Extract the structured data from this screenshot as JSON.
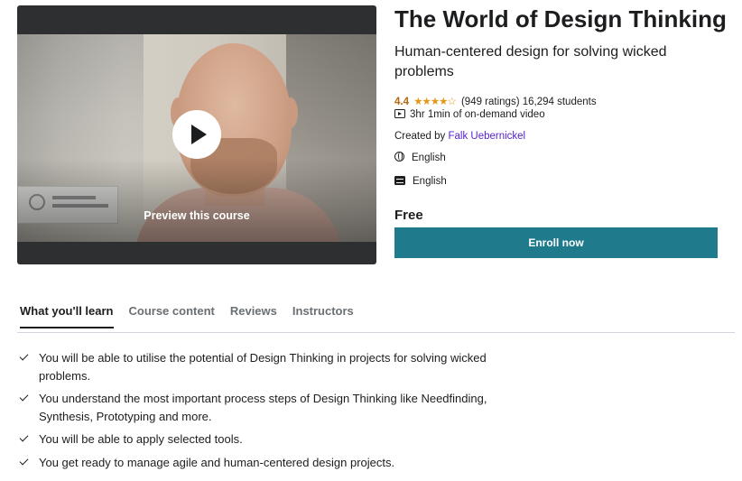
{
  "video": {
    "preview_label": "Preview this course"
  },
  "course": {
    "title": "The World of Design Thinking",
    "subtitle": "Human-centered design for solving wicked problems",
    "rating_value": "4.4",
    "stars": "★★★★☆",
    "ratings_count": "(949 ratings)",
    "students": "16,294 students",
    "duration": "3hr 1min of on-demand video",
    "created_by_label": "Created by",
    "creator": "Falk Uebernickel",
    "language": "English",
    "captions": "English",
    "price": "Free",
    "enroll_label": "Enroll now"
  },
  "tabs": [
    {
      "label": "What you'll learn",
      "active": true
    },
    {
      "label": "Course content",
      "active": false
    },
    {
      "label": "Reviews",
      "active": false
    },
    {
      "label": "Instructors",
      "active": false
    }
  ],
  "learn_items": [
    "You will be able to utilise the potential of Design Thinking in projects for solving wicked problems.",
    "You understand the most important process steps of Design Thinking like Needfinding, Synthesis, Prototyping and more.",
    "You will be able to apply selected tools.",
    "You get ready to manage agile and human-centered design projects."
  ],
  "colors": {
    "accent": "#1f7a8c",
    "rating": "#b4690e",
    "stars": "#e59819",
    "link": "#5624d0"
  },
  "icons": [
    "play-icon",
    "star-icon",
    "video-icon",
    "globe-icon",
    "closed-captions-icon",
    "check-icon"
  ]
}
